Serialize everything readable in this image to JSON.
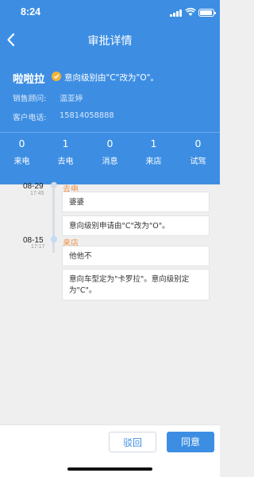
{
  "status_bar": {
    "time": "8:24"
  },
  "nav": {
    "title": "审批详情"
  },
  "customer": {
    "name": "啦啦拉",
    "level_change": "意向级别由\"C\"改为\"O\"。",
    "sales_label": "销售顾问:",
    "sales_value": "温亚婷",
    "phone_label": "客户电话:",
    "phone_value": "15814058888"
  },
  "stats": [
    {
      "value": "0",
      "label": "来电"
    },
    {
      "value": "1",
      "label": "去电"
    },
    {
      "value": "0",
      "label": "消息"
    },
    {
      "value": "1",
      "label": "来店"
    },
    {
      "value": "0",
      "label": "试驾"
    }
  ],
  "timeline": [
    {
      "date": "08-29",
      "time": "17:45",
      "type": "去电",
      "notes": [
        "婆婆",
        "意向级别申请由\"C\"改为\"O\"。"
      ]
    },
    {
      "date": "08-15",
      "time": "17:17",
      "type": "来店",
      "notes": [
        "他他不",
        "意向车型定为\"卡罗拉\"。意向级别定为\"C\"。"
      ]
    }
  ],
  "actions": {
    "reject": "驳回",
    "agree": "同意"
  },
  "colors": {
    "primary": "#3d8ee3",
    "accent": "#f0914a",
    "badge": "#f5b335"
  }
}
